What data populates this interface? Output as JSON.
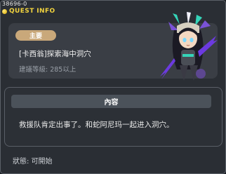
{
  "window": {
    "id_text": "38696-0",
    "title": "QUEST INFO"
  },
  "quest": {
    "category_label": "主要",
    "name": "[卡西翁]探索海中洞穴",
    "recommended_level": "建議等級: 285以上"
  },
  "content": {
    "header": "內容",
    "description": "救援队肯定出事了。和蛇阿尼玛一起进入洞穴。"
  },
  "status_text": "狀態:  可開始",
  "colors": {
    "title_gold": "#f1d33e",
    "pill_tan": "#c9a87a"
  }
}
